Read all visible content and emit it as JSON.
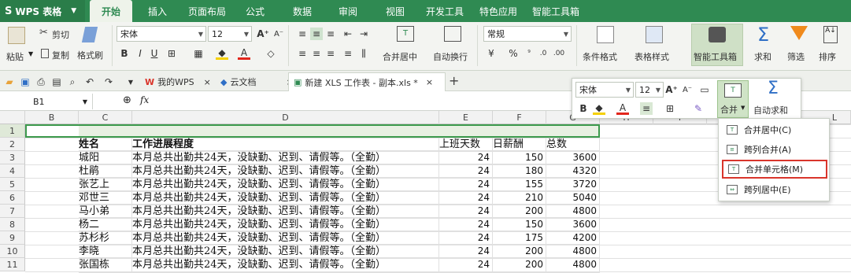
{
  "app": {
    "brand": "WPS 表格"
  },
  "menu": [
    "开始",
    "插入",
    "页面布局",
    "公式",
    "数据",
    "审阅",
    "视图",
    "开发工具",
    "特色应用",
    "智能工具箱"
  ],
  "ribbon": {
    "paste": "粘贴",
    "cut": "剪切",
    "copy": "复制",
    "format_painter": "格式刷",
    "font_name": "宋体",
    "font_size": "12",
    "merge_center": "合并居中",
    "wrap": "自动换行",
    "number_format": "常规",
    "conditional_format": "条件格式",
    "table_style": "表格样式",
    "smart_toolbox": "智能工具箱",
    "sum": "求和",
    "filter": "筛选",
    "sort": "排序"
  },
  "tabs": [
    {
      "label": "我的WPS"
    },
    {
      "label": "云文档"
    },
    {
      "label": "新建 XLS 工作表 - 副本.xls *"
    }
  ],
  "formula": {
    "cell_ref": "B1",
    "fx": "fx"
  },
  "columns": [
    "B",
    "C",
    "D",
    "E",
    "F",
    "G",
    "H",
    "I",
    "L"
  ],
  "rows": [
    "1",
    "2",
    "3",
    "4",
    "5",
    "6",
    "7",
    "8",
    "9",
    "10",
    "11"
  ],
  "header_row": {
    "name": "姓名",
    "progress": "工作进展程度",
    "days": "上班天数",
    "daily": "日薪酬",
    "total": "总数"
  },
  "table": [
    {
      "name": "城阳",
      "progress": "本月总共出勤共24天，没缺勤、迟到、请假等。（全勤）",
      "days": "24",
      "daily": "150",
      "total": "3600"
    },
    {
      "name": "杜鹃",
      "progress": "本月总共出勤共24天，没缺勤、迟到、请假等。（全勤）",
      "days": "24",
      "daily": "180",
      "total": "4320"
    },
    {
      "name": "张艺上",
      "progress": "本月总共出勤共24天，没缺勤、迟到、请假等。（全勤）",
      "days": "24",
      "daily": "155",
      "total": "3720"
    },
    {
      "name": "邓世三",
      "progress": "本月总共出勤共24天，没缺勤、迟到、请假等。（全勤）",
      "days": "24",
      "daily": "210",
      "total": "5040"
    },
    {
      "name": "马小弟",
      "progress": "本月总共出勤共24天，没缺勤、迟到、请假等。（全勤）",
      "days": "24",
      "daily": "200",
      "total": "4800"
    },
    {
      "name": "杨二",
      "progress": "本月总共出勤共24天，没缺勤、迟到、请假等。（全勤）",
      "days": "24",
      "daily": "150",
      "total": "3600"
    },
    {
      "name": "苏杉杉",
      "progress": "本月总共出勤共24天，没缺勤、迟到、请假等。（全勤）",
      "days": "24",
      "daily": "175",
      "total": "4200"
    },
    {
      "name": "李晓",
      "progress": "本月总共出勤共24天，没缺勤、迟到、请假等。（全勤）",
      "days": "24",
      "daily": "200",
      "total": "4800"
    },
    {
      "name": "张国栋",
      "progress": "本月总共出勤共24天，没缺勤、迟到、请假等。（全勤）",
      "days": "24",
      "daily": "200",
      "total": "4800"
    }
  ],
  "mini_toolbar": {
    "font_name": "宋体",
    "font_size": "12",
    "merge": "合并",
    "autosum": "自动求和"
  },
  "merge_menu": [
    {
      "label": "合并居中(C)"
    },
    {
      "label": "跨列合并(A)"
    },
    {
      "label": "合并单元格(M)"
    },
    {
      "label": "跨列居中(E)"
    }
  ],
  "colors": {
    "accent": "#2f8a52",
    "highlight_border": "#d9352b"
  }
}
